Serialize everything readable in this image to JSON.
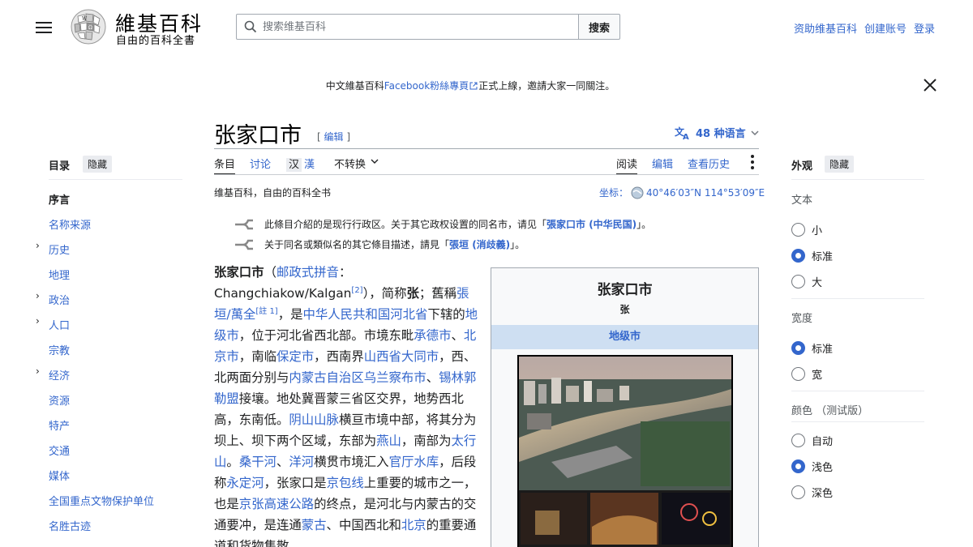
{
  "header": {
    "logo_title": "維基百科",
    "logo_tagline": "自由的百科全書",
    "search_placeholder": "搜索维基百科",
    "search_button": "搜索",
    "user_links": [
      "资助维基百科",
      "创建账号",
      "登录"
    ]
  },
  "banner": {
    "prefix": "中文維基百科",
    "link": "Facebook粉絲專頁",
    "suffix": "正式上線，邀請大家一同關注。"
  },
  "article": {
    "title": "张家口市",
    "edit_open": "[",
    "edit_label": "编辑",
    "edit_close": "]",
    "languages": "48 种语言",
    "tabs": {
      "article": "条目",
      "talk": "讨论",
      "variant_hans": "汉",
      "variant_hant": "漢",
      "convert": "不转换",
      "read": "阅读",
      "edit": "编辑",
      "history": "查看历史"
    },
    "tagline": "维基百科，自由的百科全书",
    "coords_label": "坐标：",
    "coords_value": "40°46′03″N 114°53′09″E",
    "hatnote1": {
      "pre": "此條目介紹的是现行行政区。关于其它政权设置的同名市，请见「",
      "link": "張家口市 (中华民国)",
      "post": "」。"
    },
    "hatnote2": {
      "pre": "关于同名或類似名的其它條目描述，請見「",
      "link": "張垣 (消歧義)",
      "post": "」。"
    },
    "body": {
      "lead_bold": "张家口市",
      "p1": "（",
      "postal": "邮政式拼音",
      "p2": "：Changchiakow/Kalgan",
      "ref2": "[2]",
      "p3": "），简称",
      "short": "张",
      "p4": "；舊稱",
      "zhangyuan": "張垣/萬全",
      "note1": "[註 1]",
      "p5": "，是",
      "prc": "中华人民共和国",
      "hebei": "河北省",
      "p6": "下辖的",
      "prefecture": "地级市",
      "p7": "，位于河北省西北部。市境东毗",
      "chengde": "承德市",
      "p8": "、",
      "beijing": "北京市",
      "p9": "，南临",
      "baoding": "保定市",
      "p10": "，西南界",
      "shanxi_datong": "山西省大同市",
      "p11": "，西、北两面分别与",
      "neimenggu": "内蒙古自治区",
      "wulanchabu": "乌兰察布市",
      "p12": "、",
      "xilinguole": "锡林郭勒盟",
      "p13": "接壤。地处冀晋蒙三省区交界，地势西北高，东南低。",
      "yinshan": "阴山山脉",
      "p14": "横亘市境中部，将其分为坝上、坝下两个区域，东部为",
      "yanshan": "燕山",
      "p15": "，南部为",
      "taihang": "太行山",
      "p16": "。",
      "sanggan": "桑干河",
      "p17": "、",
      "yanghe": "洋河",
      "p18": "横贯市境汇入",
      "guanting": "官厅水库",
      "p19": "，后段称",
      "yongding": "永定河",
      "p20": "，张家口是",
      "jingbao": "京包线",
      "p21": "上重要的城市之一，也是",
      "jingzhang": "京张高速公路",
      "p22": "的终点，是河北与内蒙古的交通要冲，是连通",
      "menggu": "蒙古",
      "p23": "、中国西北和",
      "beijing2": "北京",
      "p24": "的重要通道和货物集散"
    },
    "infobox": {
      "title": "张家口市",
      "subtitle": "张",
      "band": "地级市"
    }
  },
  "toc": {
    "heading": "目录",
    "hide": "隐藏",
    "items": [
      {
        "label": "序言",
        "chev": false
      },
      {
        "label": "名称来源",
        "chev": false
      },
      {
        "label": "历史",
        "chev": true
      },
      {
        "label": "地理",
        "chev": false
      },
      {
        "label": "政治",
        "chev": true
      },
      {
        "label": "人口",
        "chev": true
      },
      {
        "label": "宗教",
        "chev": false
      },
      {
        "label": "经济",
        "chev": true
      },
      {
        "label": "资源",
        "chev": false
      },
      {
        "label": "特产",
        "chev": false
      },
      {
        "label": "交通",
        "chev": false
      },
      {
        "label": "媒体",
        "chev": false
      },
      {
        "label": "全国重点文物保护单位",
        "chev": false
      },
      {
        "label": "名胜古迹",
        "chev": false
      }
    ]
  },
  "appearance": {
    "heading": "外观",
    "hide": "隐藏",
    "text_group": "文本",
    "text_small": "小",
    "text_standard": "标准",
    "text_large": "大",
    "width_group": "宽度",
    "width_standard": "标准",
    "width_wide": "宽",
    "color_group": "颜色 （测试版）",
    "color_auto": "自动",
    "color_light": "浅色",
    "color_dark": "深色"
  },
  "colors": {
    "link": "#3366cc",
    "text": "#202122",
    "infobox_band": "#cedff2"
  }
}
